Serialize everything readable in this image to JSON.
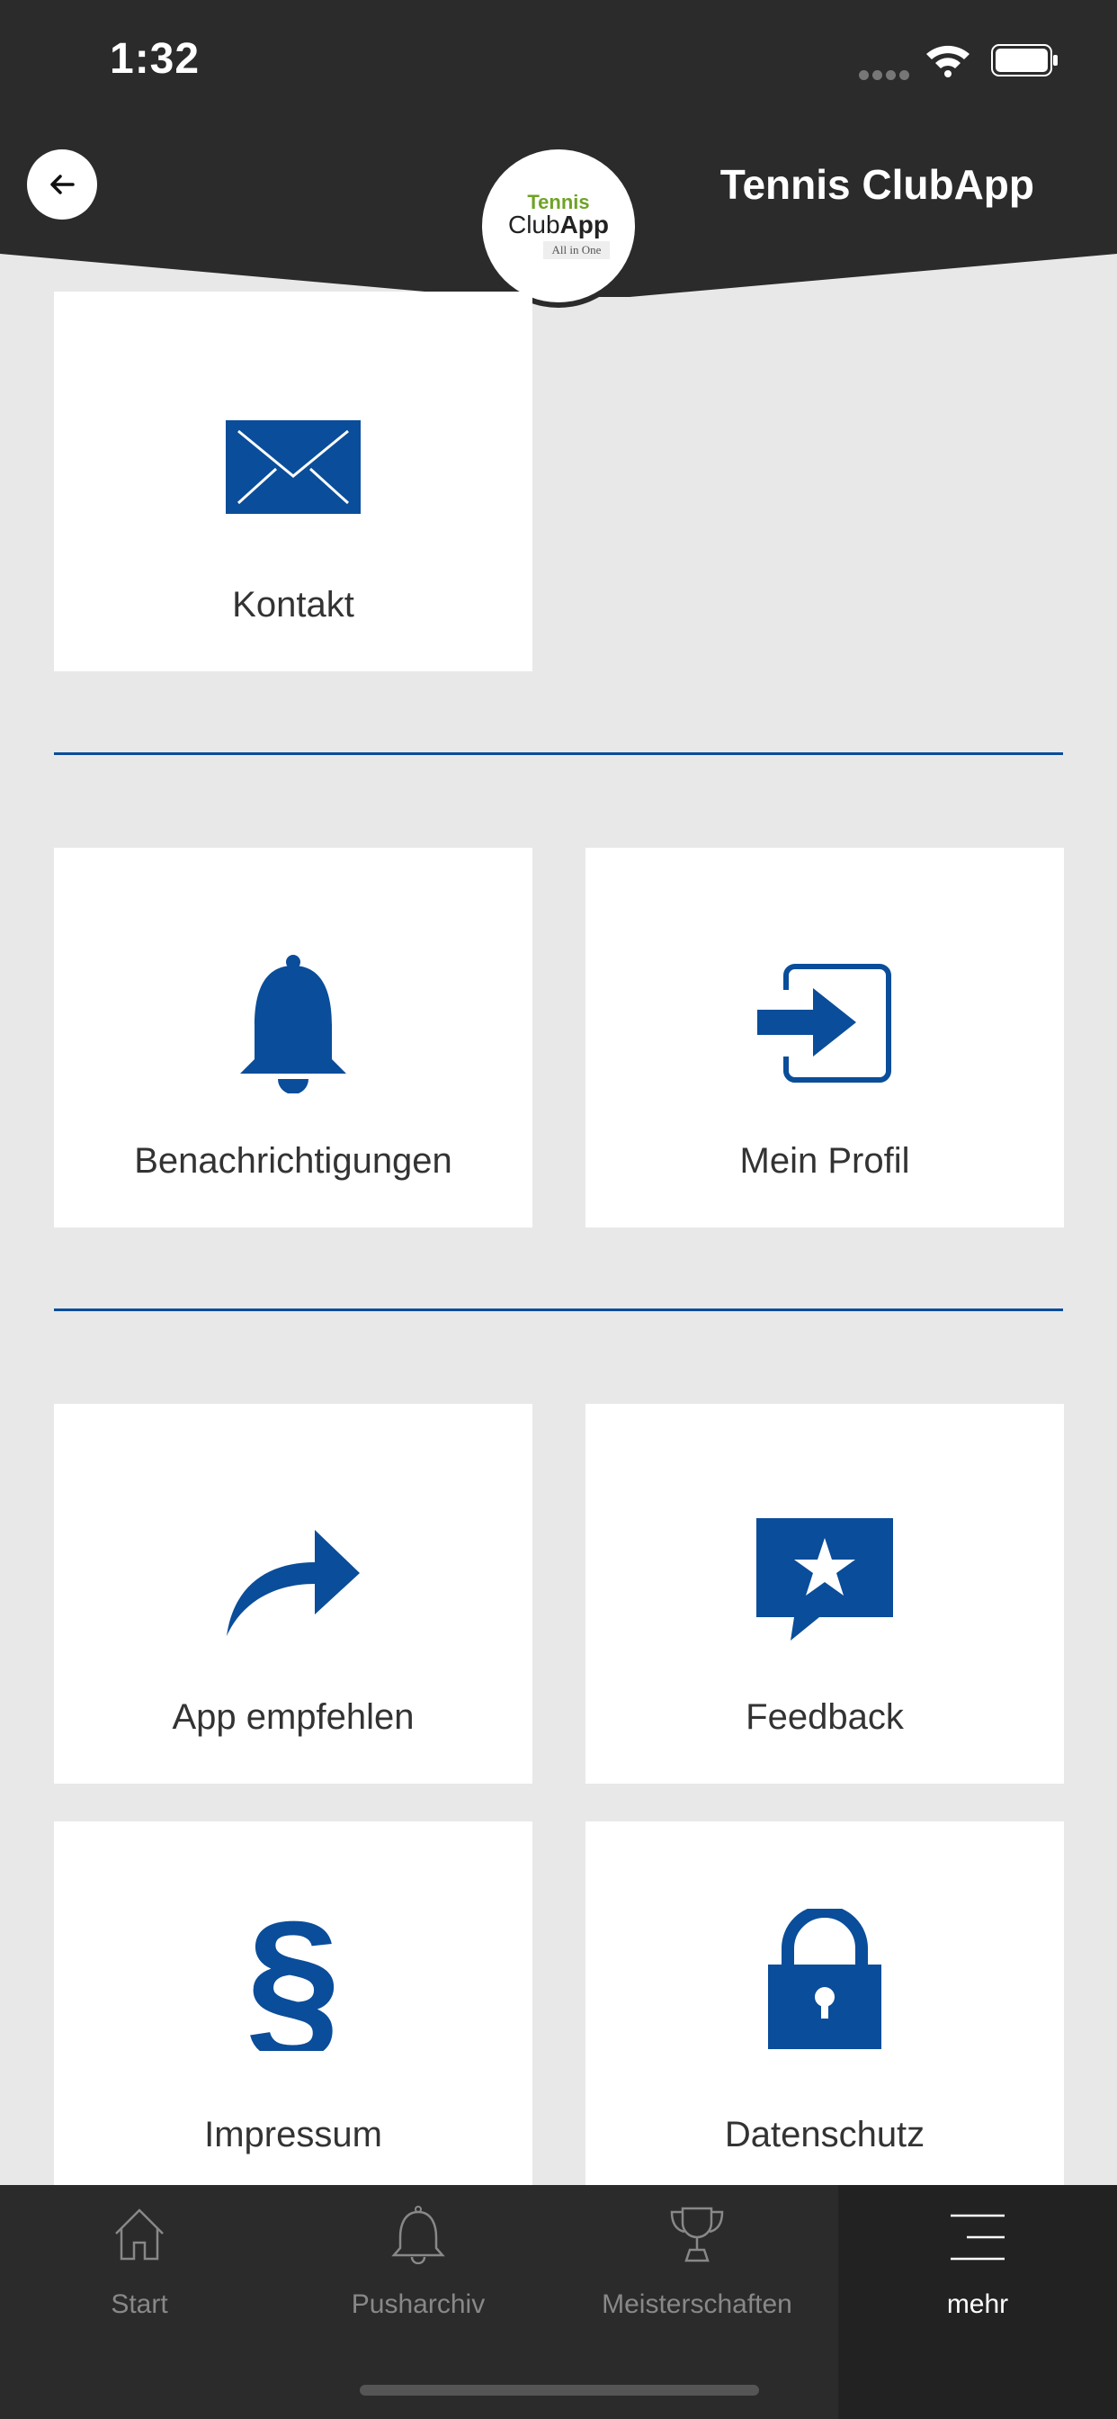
{
  "status": {
    "time": "1:32"
  },
  "header": {
    "title": "Tennis ClubApp",
    "logo": {
      "line1": "Tennis",
      "line2a": "Club",
      "line2b": "App",
      "line3": "All in One"
    }
  },
  "tiles": [
    {
      "label": "Kontakt",
      "icon": "envelope-icon"
    },
    {
      "label": "Benachrichtigungen",
      "icon": "bell-icon"
    },
    {
      "label": "Mein Profil",
      "icon": "login-arrow-icon"
    },
    {
      "label": "App empfehlen",
      "icon": "share-arrow-icon"
    },
    {
      "label": "Feedback",
      "icon": "star-speech-bubble-icon"
    },
    {
      "label": "Impressum",
      "icon": "paragraph-icon"
    },
    {
      "label": "Datenschutz",
      "icon": "lock-icon"
    }
  ],
  "tabs": [
    {
      "label": "Start",
      "icon": "home-icon"
    },
    {
      "label": "Pusharchiv",
      "icon": "bell-outline-icon"
    },
    {
      "label": "Meisterschaften",
      "icon": "trophy-icon"
    },
    {
      "label": "mehr",
      "icon": "menu-icon",
      "active": true
    }
  ],
  "colors": {
    "accent": "#0a4d9a",
    "bar": "#2b2b2b",
    "logo_green": "#6fa326"
  }
}
